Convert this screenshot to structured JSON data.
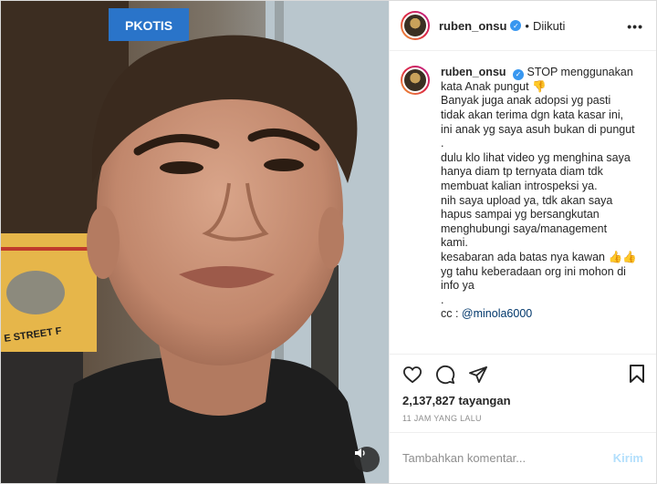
{
  "header": {
    "username": "ruben_onsu",
    "separator": "•",
    "follow_status": "Diikuti",
    "more_label": "•••",
    "verified_icon": "verified-badge-icon"
  },
  "media": {
    "sign_text": "PKOTIS",
    "banner_text": "E STREET F"
  },
  "caption": {
    "username": "ruben_onsu",
    "lines": [
      " STOP menggunakan",
      "kata Anak pungut 👎",
      "Banyak juga anak adopsi yg pasti",
      "tidak akan terima dgn kata kasar ini,",
      "ini anak yg saya asuh bukan di pungut",
      ".",
      "dulu klo lihat video yg menghina saya",
      "hanya diam tp ternyata diam tdk",
      "membuat kalian introspeksi ya.",
      "nih saya upload ya, tdk akan saya",
      "hapus sampai yg bersangkutan",
      "menghubungi saya/management",
      "kami.",
      "",
      "kesabaran ada batas nya kawan 👍👍",
      "yg tahu keberadaan org ini mohon di",
      "info ya",
      ".",
      "cc : "
    ],
    "mention": "@minola6000"
  },
  "stats": {
    "views": "2,137,827 tayangan",
    "time": "11 JAM YANG LALU"
  },
  "comment": {
    "placeholder": "Tambahkan komentar...",
    "post_label": "Kirim"
  }
}
